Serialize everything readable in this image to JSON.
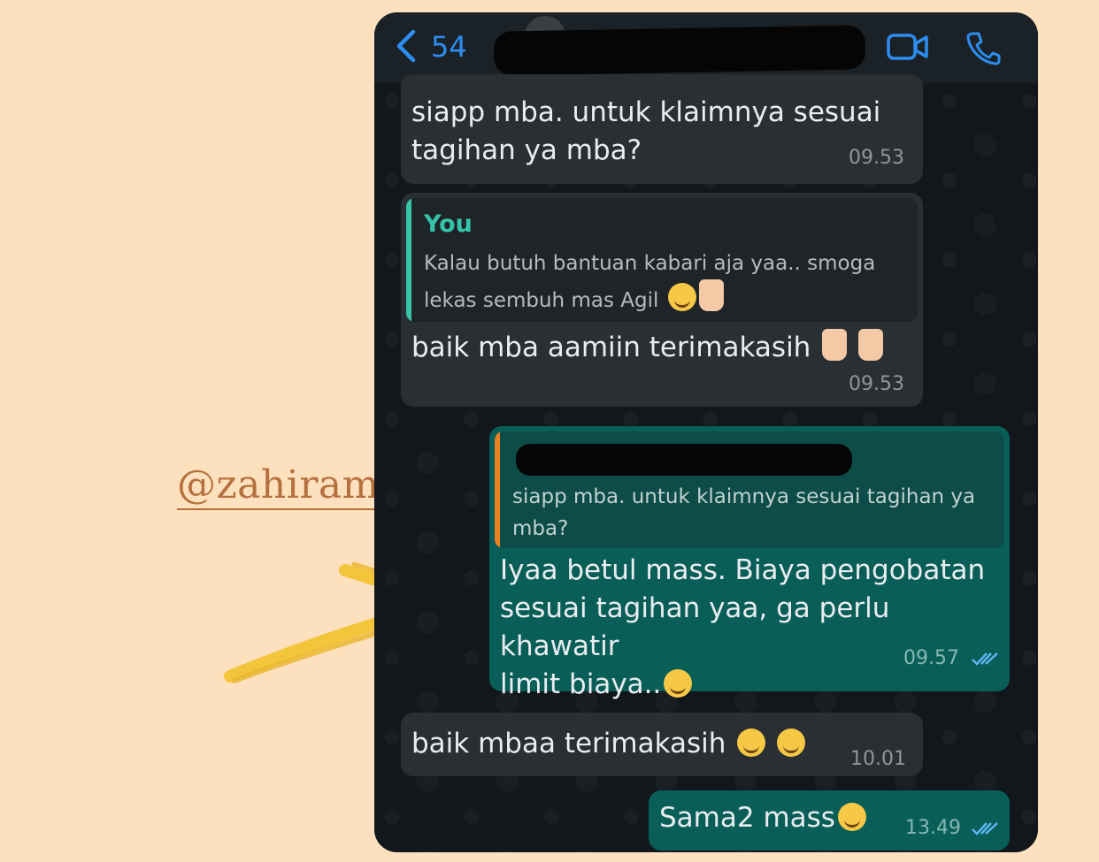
{
  "watermark": {
    "text": "@zahiramstika"
  },
  "header": {
    "back_count": "54",
    "icons": {
      "back": "chevron-left-icon",
      "video": "video-camera-icon",
      "call": "phone-icon"
    }
  },
  "messages": [
    {
      "direction": "incoming",
      "text_line1": "siapp mba. untuk klaimnya sesuai",
      "text_line2": "tagihan ya mba?",
      "time": "09.53"
    },
    {
      "direction": "incoming",
      "quote": {
        "author": "You",
        "text_line1": "Kalau butuh bantuan kabari aja yaa.. smoga",
        "text_line2": "lekas sembuh mas Agil"
      },
      "text": "baik mba aamiin terimakasih",
      "time": "09.53"
    },
    {
      "direction": "outgoing",
      "quote": {
        "text_line1": "siapp mba. untuk klaimnya sesuai tagihan ya",
        "text_line2": "mba?"
      },
      "text_line1": "Iyaa betul mass. Biaya pengobatan",
      "text_line2": "sesuai tagihan yaa, ga perlu khawatir",
      "text_line3": "limit biaya..",
      "time": "09.57"
    },
    {
      "direction": "incoming",
      "text": "baik mbaa terimakasih",
      "time": "10.01"
    },
    {
      "direction": "outgoing",
      "text": "Sama2 mass",
      "time": "13.49"
    }
  ],
  "colors": {
    "background": "#fde0bd",
    "incoming_bubble": "#2a2f33",
    "outgoing_bubble": "#0a5e58",
    "quote_you_bar": "#35c4a8",
    "quote_other_bar": "#e8821e",
    "accent_blue": "#2e8df0",
    "arrow": "#f3c53a"
  }
}
